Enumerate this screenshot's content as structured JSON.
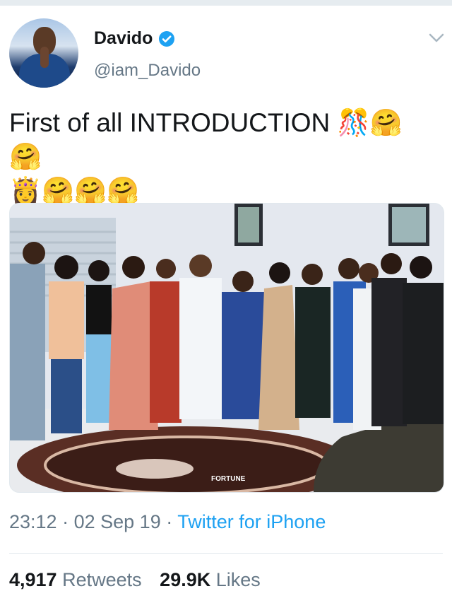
{
  "user": {
    "display_name": "Davido",
    "handle": "@iam_Davido"
  },
  "tweet": {
    "text": "First of all INTRODUCTION 🎊🤗🤗\n👸🤗🤗🤗"
  },
  "media": {
    "watermark": "FORTUNE"
  },
  "meta": {
    "time": "23:12",
    "date": "02 Sep 19",
    "separator": "·",
    "source": "Twitter for iPhone"
  },
  "stats": {
    "retweets_count": "4,917",
    "retweets_label": "Retweets",
    "likes_count": "29.9K",
    "likes_label": "Likes"
  },
  "colors": {
    "link": "#1da1f2",
    "secondary_text": "#657786",
    "primary_text": "#14171a",
    "verified": "#1da1f2"
  }
}
